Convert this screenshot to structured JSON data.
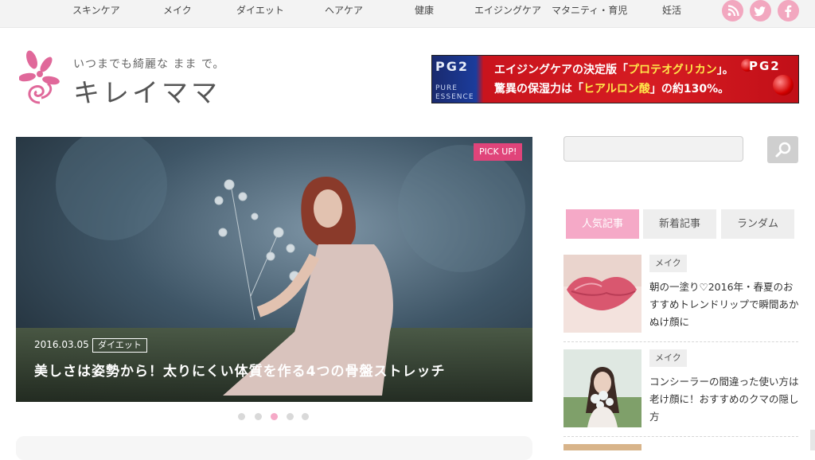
{
  "nav": {
    "items": [
      "スキンケア",
      "メイク",
      "ダイエット",
      "ヘアケア",
      "健康",
      "エイジングケア",
      "マタニティ・育児",
      "妊活"
    ],
    "social": [
      "rss-icon",
      "twitter-icon",
      "facebook-icon"
    ]
  },
  "header": {
    "tagline": "いつまでも綺麗な まま で。",
    "site_name": "キレイママ"
  },
  "banner": {
    "brand": "PG2",
    "brand_sub": "PURE ESSENCE",
    "line1_a": "エイジングケアの決定版「",
    "line1_b": "プロテオグリカン",
    "line1_c": "」。",
    "line2_a": "驚異の保湿力は「",
    "line2_b": "ヒアルロン酸",
    "line2_c": "」の約130%。",
    "brand_right": "PG2"
  },
  "hero": {
    "badge": "PICK UP!",
    "date": "2016.03.05",
    "category": "ダイエット",
    "title": "美しさは姿勢から！太りにくい体質を作る4つの骨盤ストレッチ"
  },
  "slider": {
    "active_index": 2,
    "count": 5
  },
  "sidebar": {
    "search_placeholder": "",
    "tabs": [
      "人気記事",
      "新着記事",
      "ランダム"
    ],
    "posts": [
      {
        "category": "メイク",
        "title": "朝の一塗り♡2016年・春夏のおすすめトレンドリップで瞬間あかぬけ顔に"
      },
      {
        "category": "メイク",
        "title": "コンシーラーの間違った使い方は老け顔に！おすすめのクマの隠し方"
      }
    ]
  },
  "colors": {
    "accent": "#e0447a",
    "tab_active": "#f5a9c7",
    "social": "#f2a7bf"
  }
}
